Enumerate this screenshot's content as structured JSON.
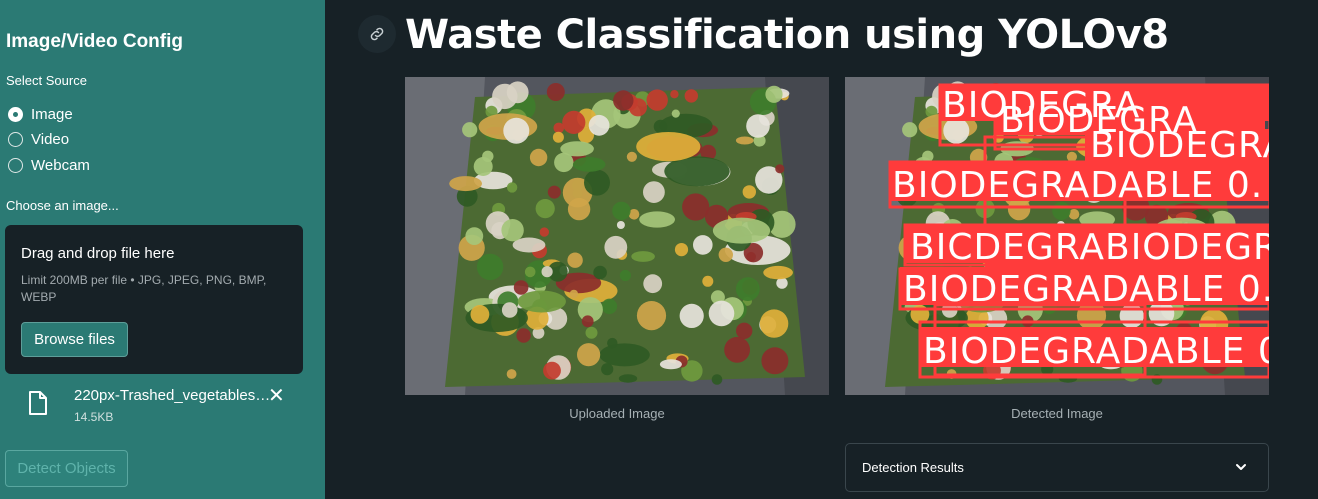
{
  "sidebar": {
    "title": "Image/Video Config",
    "select_source_label": "Select Source",
    "sources": [
      {
        "label": "Image",
        "selected": true
      },
      {
        "label": "Video",
        "selected": false
      },
      {
        "label": "Webcam",
        "selected": false
      }
    ],
    "choose_label": "Choose an image...",
    "uploader": {
      "title": "Drag and drop file here",
      "hint": "Limit 200MB per file • JPG, JPEG, PNG, BMP, WEBP",
      "browse_label": "Browse files"
    },
    "file": {
      "name": "220px-Trashed_vegetables…",
      "size": "14.5KB",
      "icon": "file-icon",
      "close_icon": "close-icon"
    },
    "detect_label": "Detect Objects"
  },
  "main": {
    "title": "Waste Classification using YOLOv8",
    "uploaded_caption": "Uploaded Image",
    "detected_caption": "Detected Image",
    "detection_results_label": "Detection Results",
    "detection_label_text": "BIODEGRADABLE",
    "detection_partial_texts": [
      "BIODEGRA",
      "BIODEGRA",
      "BIODEGRA",
      "BIODEGRADABLE 0.",
      "BICDEGRABIODEGRAD",
      "BIODEGRADABLE 0.",
      "BIODEGRADABLE 0"
    ]
  },
  "colors": {
    "sidebar_bg": "#2b7a74",
    "main_bg": "#172126",
    "detection_box": "#ff3b3b"
  }
}
